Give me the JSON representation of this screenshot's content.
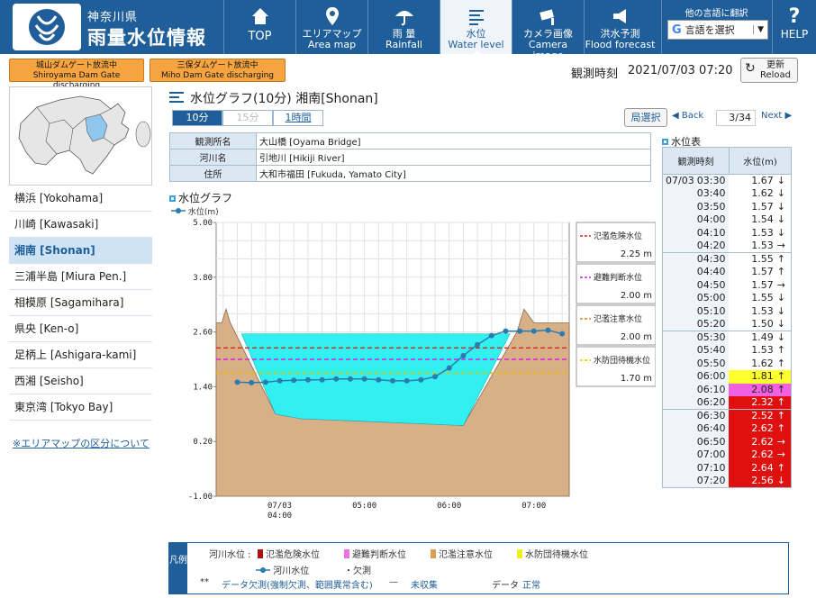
{
  "header": {
    "brand_sub": "神奈川県",
    "brand_main": "雨量水位情報",
    "nav": [
      {
        "label": "TOP",
        "en": "",
        "icon": "home-icon"
      },
      {
        "label": "エリアマップ",
        "en": "Area map",
        "icon": "map-pin-icon"
      },
      {
        "label": "雨 量",
        "en": "Rainfall",
        "icon": "umbrella-icon"
      },
      {
        "label": "水位",
        "en": "Water level",
        "icon": "water-level-icon"
      },
      {
        "label": "カメラ画像",
        "en": "Camera image",
        "icon": "camera-icon"
      },
      {
        "label": "洪水予測",
        "en": "Flood forecast",
        "icon": "megaphone-icon"
      }
    ],
    "lang_title": "他の言語に翻訳",
    "lang_select": "言語を選択",
    "help": "HELP"
  },
  "topbar": {
    "dam1_jp": "城山ダムゲート放流中",
    "dam1_en": "Shiroyama Dam Gate discharging",
    "dam2_jp": "三保ダムゲート放流中",
    "dam2_en": "Miho Dam Gate discharging",
    "obs_label": "観測時刻",
    "obs_time": "2021/07/03 07:20",
    "reload_jp": "更新",
    "reload_en": "Reload"
  },
  "sidebar": {
    "items": [
      "横浜 [Yokohama]",
      "川崎 [Kawasaki]",
      "湘南 [Shonan]",
      "三浦半島 [Miura Pen.]",
      "相模原 [Sagamihara]",
      "県央 [Ken-o]",
      "足柄上 [Ashigara-kami]",
      "西湘 [Seisho]",
      "東京湾 [Tokyo Bay]"
    ],
    "active_index": 2,
    "link": "※エリアマップの区分について"
  },
  "main": {
    "title": "水位グラフ(10分) 湘南[Shonan]",
    "tabs": [
      "10分",
      "15分",
      "1時間"
    ],
    "area_btn": "局選択",
    "back": "◀ Back",
    "page": "3/34",
    "next": "Next ▶",
    "info": [
      {
        "k": "観測所名",
        "v": "大山橋 [Oyama Bridge]"
      },
      {
        "k": "河川名",
        "v": "引地川 [Hikiji River]"
      },
      {
        "k": "住所",
        "v": "大和市福田 [Fukuda, Yamato City]"
      }
    ],
    "graph_title": "水位グラフ",
    "graph_series_label": "水位(m)"
  },
  "chart_data": {
    "type": "line",
    "ylabel": "水位(m)",
    "ylim": [
      -1.0,
      5.0
    ],
    "yticks": [
      "5.00",
      "3.80",
      "2.60",
      "1.40",
      "0.20",
      "-1.00"
    ],
    "xticks": [
      {
        "label": "07/03\n04:00",
        "t": 0
      },
      {
        "label": "05:00",
        "t": 60
      },
      {
        "label": "06:00",
        "t": 120
      },
      {
        "label": "07:00",
        "t": 180
      }
    ],
    "x_minutes_from_0400": [
      -30,
      -20,
      -10,
      0,
      10,
      20,
      30,
      40,
      50,
      60,
      70,
      80,
      90,
      100,
      110,
      120,
      130,
      140,
      150,
      160,
      170,
      180,
      190,
      200
    ],
    "values": [
      1.5,
      1.49,
      1.5,
      1.53,
      1.54,
      1.55,
      1.55,
      1.57,
      1.57,
      1.57,
      1.55,
      1.53,
      1.53,
      1.55,
      1.62,
      1.81,
      2.08,
      2.32,
      2.52,
      2.62,
      2.62,
      2.62,
      2.64,
      2.56
    ],
    "thresholds": [
      {
        "name": "氾濫危険水位",
        "value": 2.25,
        "label": "2.25 m",
        "color": "#e02020"
      },
      {
        "name": "避難判断水位",
        "value": 2.0,
        "label": "2.00 m",
        "color": "#e020e0"
      },
      {
        "name": "氾濫注意水位",
        "value": 2.0,
        "label": "2.00 m",
        "color": "#e08020"
      },
      {
        "name": "水防団待機水位",
        "value": 1.7,
        "label": "1.70 m",
        "color": "#e0c000"
      }
    ]
  },
  "table": {
    "title": "水位表",
    "headers": [
      "観測時刻",
      "水位(m)"
    ],
    "date_prefix": "07/03",
    "rows": [
      {
        "t": "03:30",
        "v": "1.67",
        "a": "↓",
        "bg": ""
      },
      {
        "t": "03:40",
        "v": "1.62",
        "a": "↓",
        "bg": ""
      },
      {
        "t": "03:50",
        "v": "1.57",
        "a": "↓",
        "bg": ""
      },
      {
        "t": "04:00",
        "v": "1.54",
        "a": "↓",
        "bg": ""
      },
      {
        "t": "04:10",
        "v": "1.53",
        "a": "↓",
        "bg": ""
      },
      {
        "t": "04:20",
        "v": "1.53",
        "a": "→",
        "bg": ""
      },
      {
        "t": "04:30",
        "v": "1.55",
        "a": "↑",
        "bg": ""
      },
      {
        "t": "04:40",
        "v": "1.57",
        "a": "↑",
        "bg": ""
      },
      {
        "t": "04:50",
        "v": "1.57",
        "a": "→",
        "bg": ""
      },
      {
        "t": "05:00",
        "v": "1.55",
        "a": "↓",
        "bg": ""
      },
      {
        "t": "05:10",
        "v": "1.53",
        "a": "↓",
        "bg": ""
      },
      {
        "t": "05:20",
        "v": "1.50",
        "a": "↓",
        "bg": ""
      },
      {
        "t": "05:30",
        "v": "1.49",
        "a": "↓",
        "bg": ""
      },
      {
        "t": "05:40",
        "v": "1.53",
        "a": "↑",
        "bg": ""
      },
      {
        "t": "05:50",
        "v": "1.62",
        "a": "↑",
        "bg": ""
      },
      {
        "t": "06:00",
        "v": "1.81",
        "a": "↑",
        "bg": "#ffff30"
      },
      {
        "t": "06:10",
        "v": "2.08",
        "a": "↑",
        "bg": "#f060e0"
      },
      {
        "t": "06:20",
        "v": "2.32",
        "a": "↑",
        "bg": "#e01010"
      },
      {
        "t": "06:30",
        "v": "2.52",
        "a": "↑",
        "bg": "#e01010"
      },
      {
        "t": "06:40",
        "v": "2.62",
        "a": "↑",
        "bg": "#e01010"
      },
      {
        "t": "06:50",
        "v": "2.62",
        "a": "→",
        "bg": "#e01010"
      },
      {
        "t": "07:00",
        "v": "2.62",
        "a": "→",
        "bg": "#e01010"
      },
      {
        "t": "07:10",
        "v": "2.64",
        "a": "↑",
        "bg": "#e01010"
      },
      {
        "t": "07:20",
        "v": "2.56",
        "a": "↓",
        "bg": "#e01010"
      }
    ]
  },
  "legend": {
    "side": "凡例",
    "river_label": "河川水位 :",
    "items": [
      {
        "name": "氾濫危険水位",
        "color": "#b01010"
      },
      {
        "name": "避難判断水位",
        "color": "#f070e0"
      },
      {
        "name": "氾濫注意水位",
        "color": "#d8a050"
      },
      {
        "name": "水防団待機水位",
        "color": "#f0f020"
      }
    ],
    "line_label": "河川水位",
    "missing_label": "欠測",
    "dash_mark": "**",
    "dash_desc": "データ欠測(強制欠測、範囲異常含む)",
    "uncollected_mark": "—",
    "uncollected_desc": "未収集",
    "normal_label": "データ",
    "normal_desc": "正常"
  },
  "colors": {
    "header": "#1f5e98",
    "water": "#33f0f0",
    "ground": "#d8b088"
  }
}
